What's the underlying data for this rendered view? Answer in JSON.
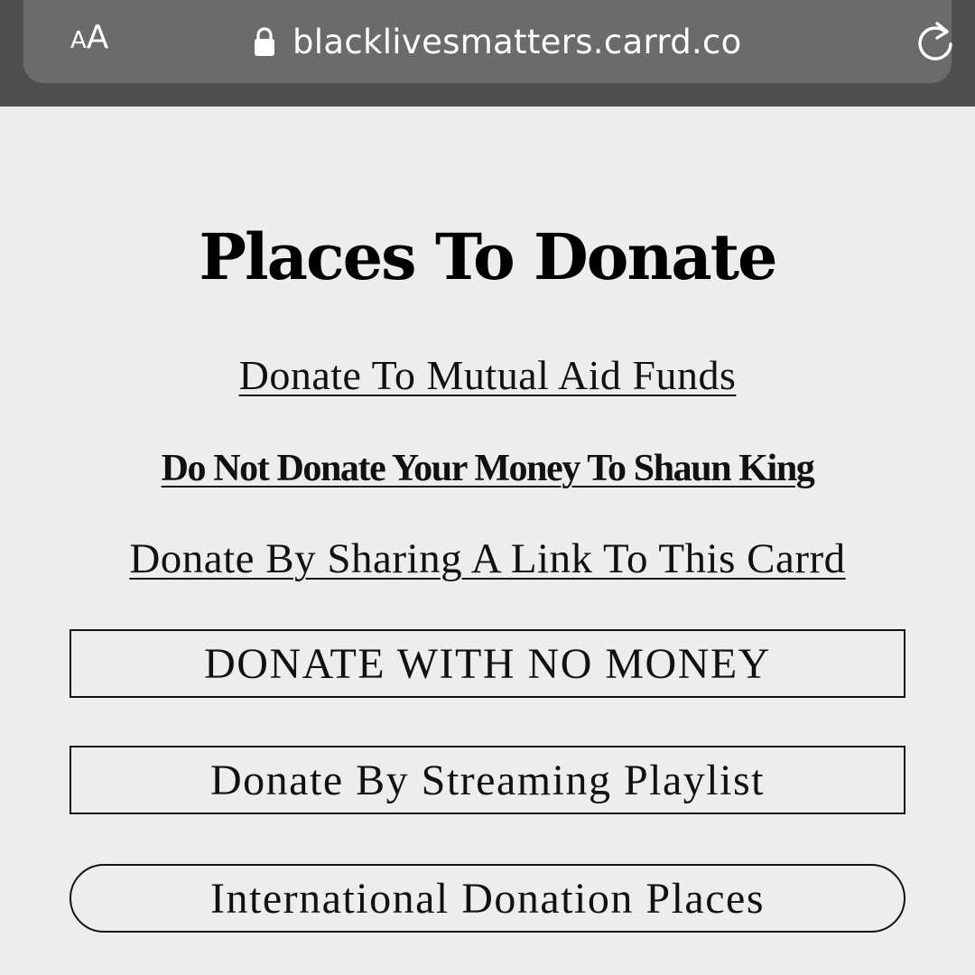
{
  "browser": {
    "text_size_small": "A",
    "text_size_big": "A",
    "url": "blacklivesmatters.carrd.co",
    "icons": {
      "lock": "lock-icon",
      "reload": "reload-icon"
    }
  },
  "page": {
    "title": "Places To Donate",
    "links": [
      "Donate To Mutual Aid Funds",
      "Do Not Donate Your Money To Shaun King",
      "Donate By Sharing A Link To This Carrd"
    ],
    "buttons": [
      "DONATE WITH NO MONEY",
      "Donate By Streaming Playlist",
      "International Donation Places"
    ]
  },
  "colors": {
    "page_background": "#ededed",
    "chrome_background": "#4f4f4f",
    "urlbar_background": "#6b6b6b",
    "text": "#0d0d0d"
  }
}
